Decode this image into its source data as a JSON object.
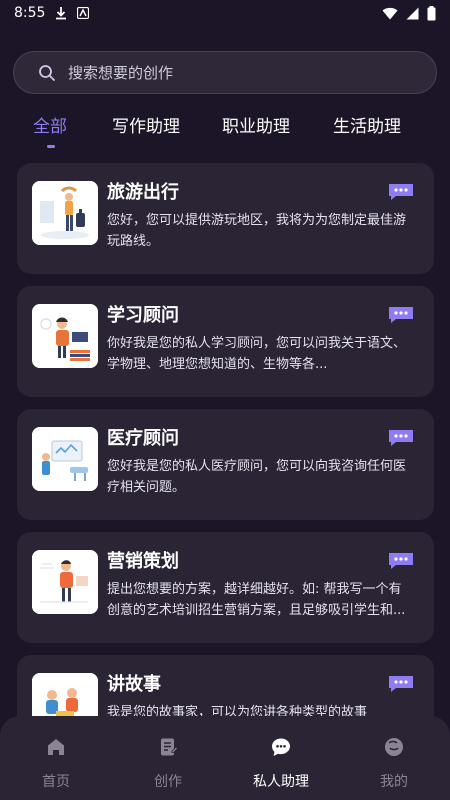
{
  "status": {
    "time": "8:55"
  },
  "search": {
    "placeholder": "搜索想要的创作"
  },
  "tabs": [
    {
      "label": "全部",
      "active": true
    },
    {
      "label": "写作助理",
      "active": false
    },
    {
      "label": "职业助理",
      "active": false
    },
    {
      "label": "生活助理",
      "active": false
    }
  ],
  "cards": [
    {
      "title": "旅游出行",
      "desc": "您好，您可以提供游玩地区，我将为为您制定最佳游玩路线。",
      "icon": "travel-illustration"
    },
    {
      "title": "学习顾问",
      "desc": "你好我是您的私人学习顾问，您可以问我关于语文、学物理、地理您想知道的、生物等各...",
      "icon": "study-illustration"
    },
    {
      "title": "医疗顾问",
      "desc": "您好我是您的私人医疗顾问，您可以向我咨询任何医疗相关问题。",
      "icon": "medical-illustration"
    },
    {
      "title": "营销策划",
      "desc": "提出您想要的方案，越详细越好。如: 帮我写一个有创意的艺术培训招生营销方案，且足够吸引学生和...",
      "icon": "marketing-illustration"
    },
    {
      "title": "讲故事",
      "desc": "我是您的故事家，可以为您讲各种类型的故事",
      "icon": "story-illustration"
    }
  ],
  "bottom_nav": [
    {
      "label": "首页",
      "icon": "home-icon",
      "active": false
    },
    {
      "label": "创作",
      "icon": "document-edit-icon",
      "active": false
    },
    {
      "label": "私人助理",
      "icon": "chat-bubble-icon",
      "active": true
    },
    {
      "label": "我的",
      "icon": "profile-icon",
      "active": false
    }
  ],
  "colors": {
    "background": "#1c1527",
    "card": "#2a2435",
    "accent": "#8f7cf2"
  }
}
